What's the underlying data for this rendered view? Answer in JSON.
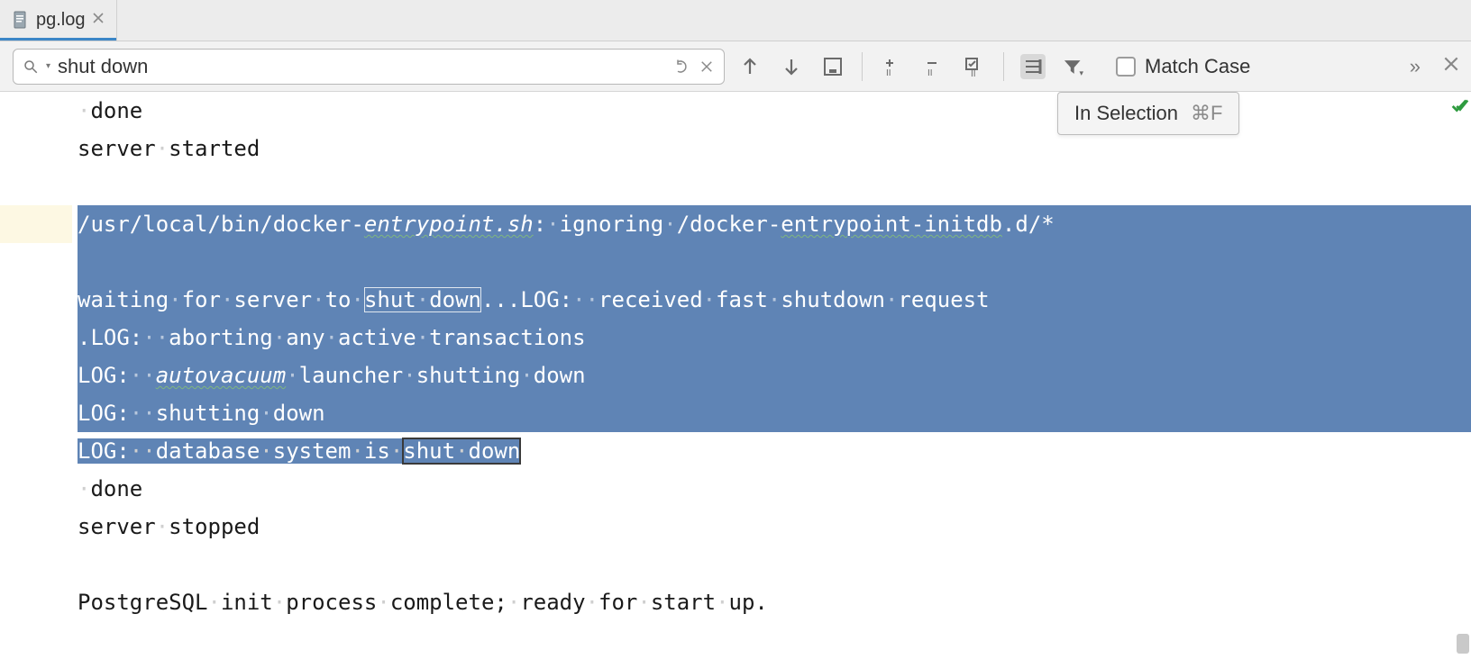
{
  "tab": {
    "filename": "pg.log"
  },
  "search": {
    "query": "shut down",
    "placeholder": "",
    "match_case_label": "Match Case",
    "tooltip_label": "In Selection",
    "tooltip_shortcut": "⌘F"
  },
  "editor": {
    "lines": [
      {
        "text": " done",
        "selected": false
      },
      {
        "text": "server started",
        "selected": false
      },
      {
        "text": "",
        "selected": false
      },
      {
        "text": "/usr/local/bin/docker-entrypoint.sh: ignoring /docker-entrypoint-initdb.d/*",
        "selected": true,
        "squiggle_segment": "entrypoint.sh",
        "squiggle2": "entrypoint-initdb"
      },
      {
        "text": "",
        "selected": true
      },
      {
        "text": "waiting for server to shut down...LOG:  received fast shutdown request",
        "selected": true,
        "hit_in_sel": "shut down"
      },
      {
        "text": ".LOG:  aborting any active transactions",
        "selected": true
      },
      {
        "text": "LOG:  autovacuum launcher shutting down",
        "selected": true,
        "squiggle_segment": "autovacuum"
      },
      {
        "text": "LOG:  shutting down",
        "selected": true
      },
      {
        "text": "LOG:  database system is shut down",
        "selected_partial_until": "shut down",
        "hit_out": "shut down"
      },
      {
        "text": " done",
        "selected": false
      },
      {
        "text": "server stopped",
        "selected": false
      },
      {
        "text": "",
        "selected": false
      },
      {
        "text": "PostgreSQL init process complete; ready for start up.",
        "selected": false
      }
    ],
    "caret_line_index": 3
  },
  "icons": {
    "prev": "arrow-up-icon",
    "next": "arrow-down-icon",
    "select_all": "select-all-occurrences-icon",
    "add_selection": "add-selection-icon",
    "remove_selection": "remove-selection-icon",
    "toggle_case": "preserve-case-icon",
    "in_selection": "in-selection-icon",
    "filter": "filter-icon"
  }
}
